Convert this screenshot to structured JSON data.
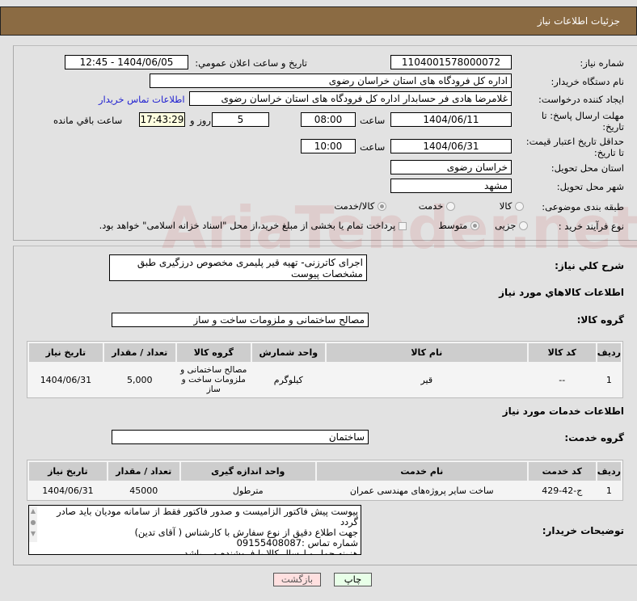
{
  "header": {
    "title": "جزئیات اطلاعات نیاز"
  },
  "form": {
    "need_number_label": "شماره نیاز:",
    "need_number": "1104001578000072",
    "announce_label": "تاریخ و ساعت اعلان عمومي:",
    "announce_value": "1404/06/05 - 12:45",
    "buyer_org_label": "نام دستگاه خریدار:",
    "buyer_org": "اداره کل فرودگاه های استان خراسان رضوی",
    "creator_label": "ایجاد کننده درخواست:",
    "creator": "غلامرضا هادی فر حسابدار اداره کل فرودگاه های استان خراسان رضوی",
    "contact_link": "اطلاعات تماس خریدار",
    "deadline_label": "مهلت ارسال پاسخ: تا تاریخ:",
    "deadline_date": "1404/06/11",
    "time_label": "ساعت",
    "deadline_time": "08:00",
    "days": "5",
    "days_label": "روز و",
    "remaining": "17:43:29",
    "remaining_label": "ساعت باقي مانده",
    "validity_label": "حداقل تاریخ اعتبار قیمت: تا تاریخ:",
    "validity_date": "1404/06/31",
    "validity_time": "10:00",
    "province_label": "استان محل تحویل:",
    "province": "خراسان رضوی",
    "city_label": "شهر محل تحویل:",
    "city": "مشهد",
    "category_label": "طبقه بندی موضوعی:",
    "category_options": [
      "کالا",
      "خدمت",
      "کالا/خدمت"
    ],
    "process_label": "نوع فرآیند خرید :",
    "process_options": [
      "جزیی",
      "متوسط"
    ],
    "payment_note": "پرداخت تمام یا بخشی از مبلغ خرید،از محل \"اسناد خزانه اسلامی\" خواهد بود."
  },
  "description": {
    "label": "شرح كلي نیاز:",
    "value": "اجرای کاترزنی- تهیه قیر پلیمری مخصوص درزگیری طبق مشخصات پیوست"
  },
  "goods": {
    "heading": "اطلاعات کالاهاي مورد نیاز",
    "group_label": "گروه کالا:",
    "group": "مصالح ساختمانی و ملزومات ساخت و ساز",
    "columns": [
      "ردیف",
      "کد کالا",
      "نام کالا",
      "واحد شمارش",
      "گروه کالا",
      "تعداد / مقدار",
      "تاریخ نیاز"
    ],
    "rows": [
      [
        "1",
        "--",
        "قیر",
        "کیلوگرم",
        "مصالح ساختمانی و ملزومات ساخت و ساز",
        "5,000",
        "1404/06/31"
      ]
    ]
  },
  "services": {
    "heading": "اطلاعات خدمات مورد نیاز",
    "group_label": "گروه خدمت:",
    "group": "ساختمان",
    "columns": [
      "ردیف",
      "کد خدمت",
      "نام خدمت",
      "واحد اندازه گیری",
      "تعداد / مقدار",
      "تاریخ نیاز"
    ],
    "rows": [
      [
        "1",
        "ج-42-429",
        "ساخت سایر پروژه‌های مهندسی عمران",
        "مترطول",
        "45000",
        "1404/06/31"
      ]
    ]
  },
  "buyer_notes": {
    "label": "توضیحات خریدار:",
    "lines": [
      "پیوست پیش فاکتور الزامیست و صدور فاکتور فقط از سامانه مودیان باید صادر گردد",
      "جهت اطلاع دقیق از نوع سفارش با کارشناس   ( آقای تدین)",
      "شماره تماس :09155408087",
      "هزینه حمل و ارسال کالا با فروشنده می باشد"
    ]
  },
  "buttons": {
    "print": "چاپ",
    "back": "بازگشت"
  },
  "colors": {
    "header": "#8b6b43",
    "back_btn": "#ffe0e0",
    "print_btn": "#e8ffe8",
    "remaining_bg": "#ffffe0"
  }
}
